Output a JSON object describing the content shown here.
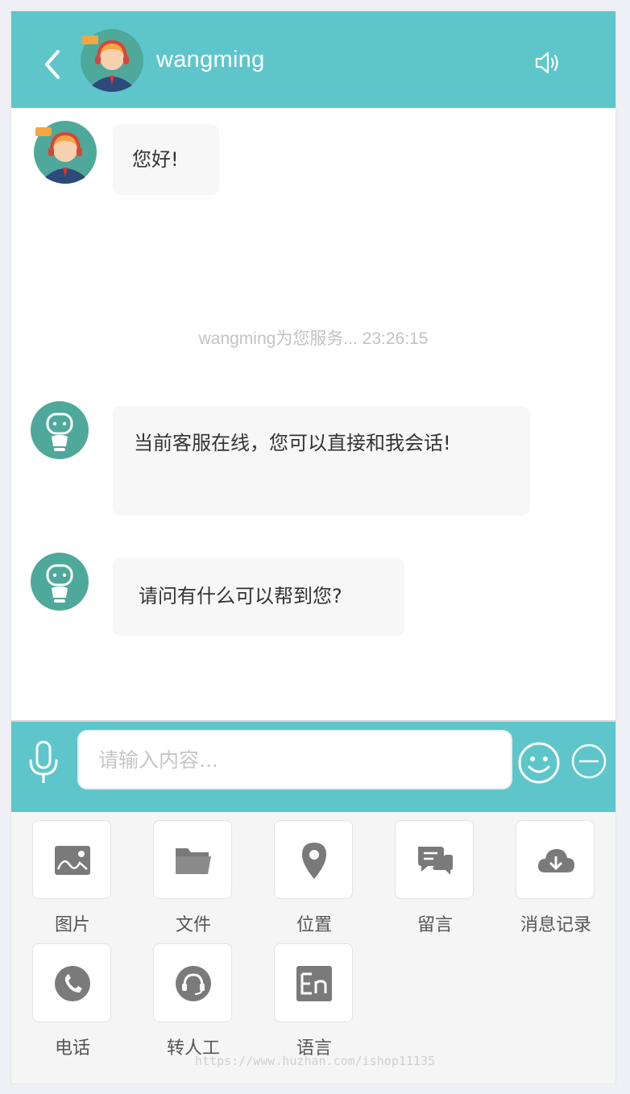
{
  "header": {
    "title": "wangming",
    "back_icon": "chevron-left-icon",
    "sound_icon": "speaker-icon",
    "bg_color": "#5ec6cb"
  },
  "messages": [
    {
      "sender": "agent",
      "avatar": "support-agent-avatar",
      "text": "您好!"
    },
    {
      "sender": "robot",
      "avatar": "robot-avatar",
      "text": "当前客服在线，您可以直接和我会话!"
    },
    {
      "sender": "robot",
      "avatar": "robot-avatar",
      "text": "请问有什么可以帮到您?"
    }
  ],
  "system_note": "wangming为您服务...  23:26:15",
  "input": {
    "placeholder": "请输入内容...",
    "value": "",
    "mic_icon": "microphone-icon",
    "emoji_icon": "smiley-icon",
    "more_icon": "minus-circle-icon"
  },
  "tools": [
    {
      "label": "图片",
      "icon": "image-icon"
    },
    {
      "label": "文件",
      "icon": "folder-icon"
    },
    {
      "label": "位置",
      "icon": "location-pin-icon"
    },
    {
      "label": "留言",
      "icon": "chat-bubbles-icon"
    },
    {
      "label": "消息记录",
      "icon": "cloud-download-icon"
    },
    {
      "label": "电话",
      "icon": "phone-icon"
    },
    {
      "label": "转人工",
      "icon": "headset-icon"
    },
    {
      "label": "语言",
      "icon": "language-en-icon"
    }
  ],
  "watermark": "https://www.huzhan.com/ishop11135"
}
